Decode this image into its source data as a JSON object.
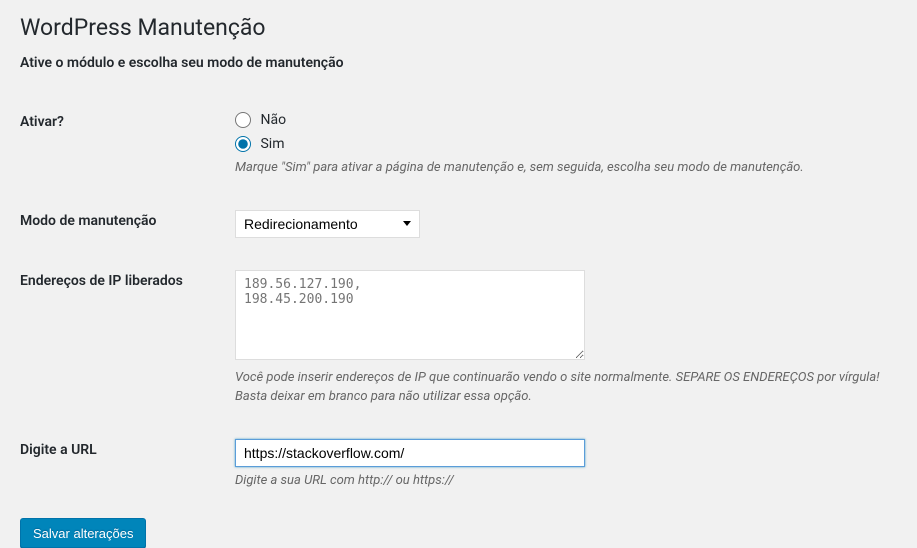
{
  "page": {
    "title": "WordPress Manutenção",
    "subtitle": "Ative o módulo e escolha seu modo de manutenção"
  },
  "fields": {
    "activate": {
      "label": "Ativar?",
      "option_no": "Não",
      "option_yes": "Sim",
      "description": "Marque \"Sim\" para ativar a página de manutenção e, sem seguida, escolha seu modo de manutenção."
    },
    "mode": {
      "label": "Modo de manutenção",
      "selected": "Redirecionamento"
    },
    "ips": {
      "label": "Endereços de IP liberados",
      "placeholder": "189.56.127.190,\n198.45.200.190",
      "description": "Você pode inserir endereços de IP que continuarão vendo o site normalmente. SEPARE OS ENDEREÇOS por vírgula! Basta deixar em branco para não utilizar essa opção."
    },
    "url": {
      "label": "Digite a URL",
      "value": "https://stackoverflow.com/",
      "description": "Digite a sua URL com http:// ou https://"
    }
  },
  "actions": {
    "save": "Salvar alterações"
  }
}
